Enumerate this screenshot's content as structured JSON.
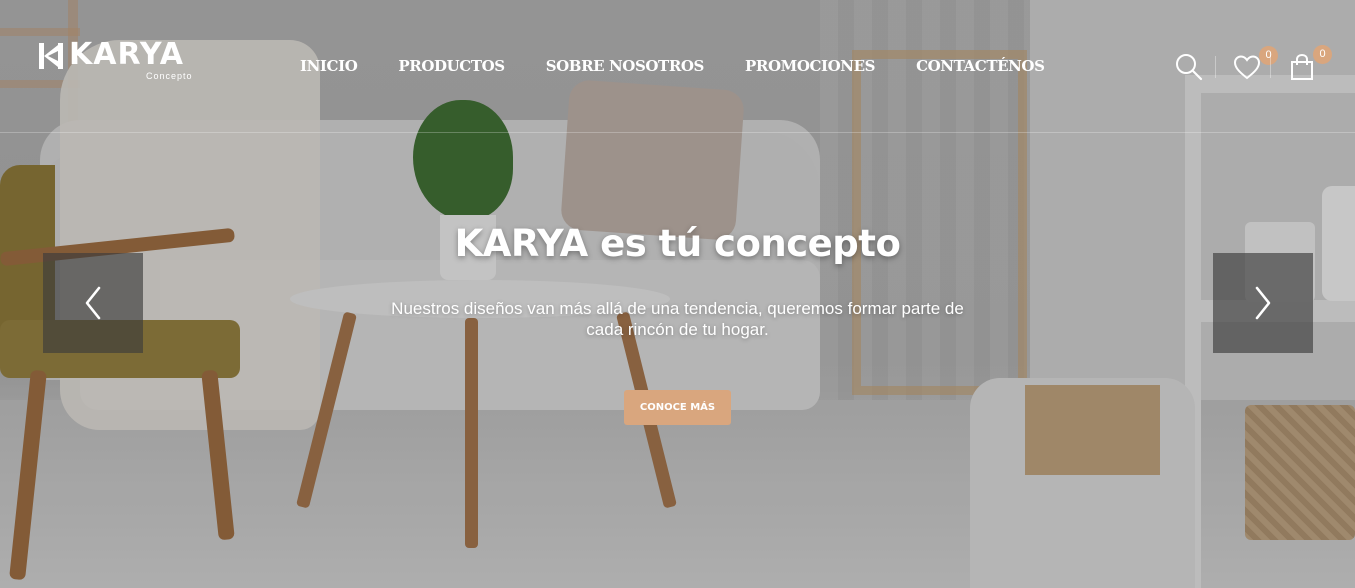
{
  "brand": {
    "logo_text": "KARYA",
    "logo_subtext": "Concepto"
  },
  "nav": {
    "items": [
      {
        "label": "INICIO"
      },
      {
        "label": "PRODUCTOS"
      },
      {
        "label": "SOBRE NOSOTROS"
      },
      {
        "label": "PROMOCIONES"
      },
      {
        "label": "CONTACTÉNOS"
      }
    ]
  },
  "header_icons": {
    "search": "search-icon",
    "wishlist": "heart-icon",
    "wishlist_count": "0",
    "cart": "shopping-bag-icon",
    "cart_count": "0"
  },
  "hero": {
    "title": "KARYA es tú concepto",
    "text": "Nuestros diseños van más allá de una tendencia, queremos formar parte de cada rincón de tu hogar.",
    "cta_label": "CONOCE MÁS",
    "prev_icon": "chevron-left-icon",
    "next_icon": "chevron-right-icon"
  },
  "colors": {
    "accent": "#d9a67e",
    "text": "#ffffff",
    "arrow_bg": "#3c3c3c"
  }
}
